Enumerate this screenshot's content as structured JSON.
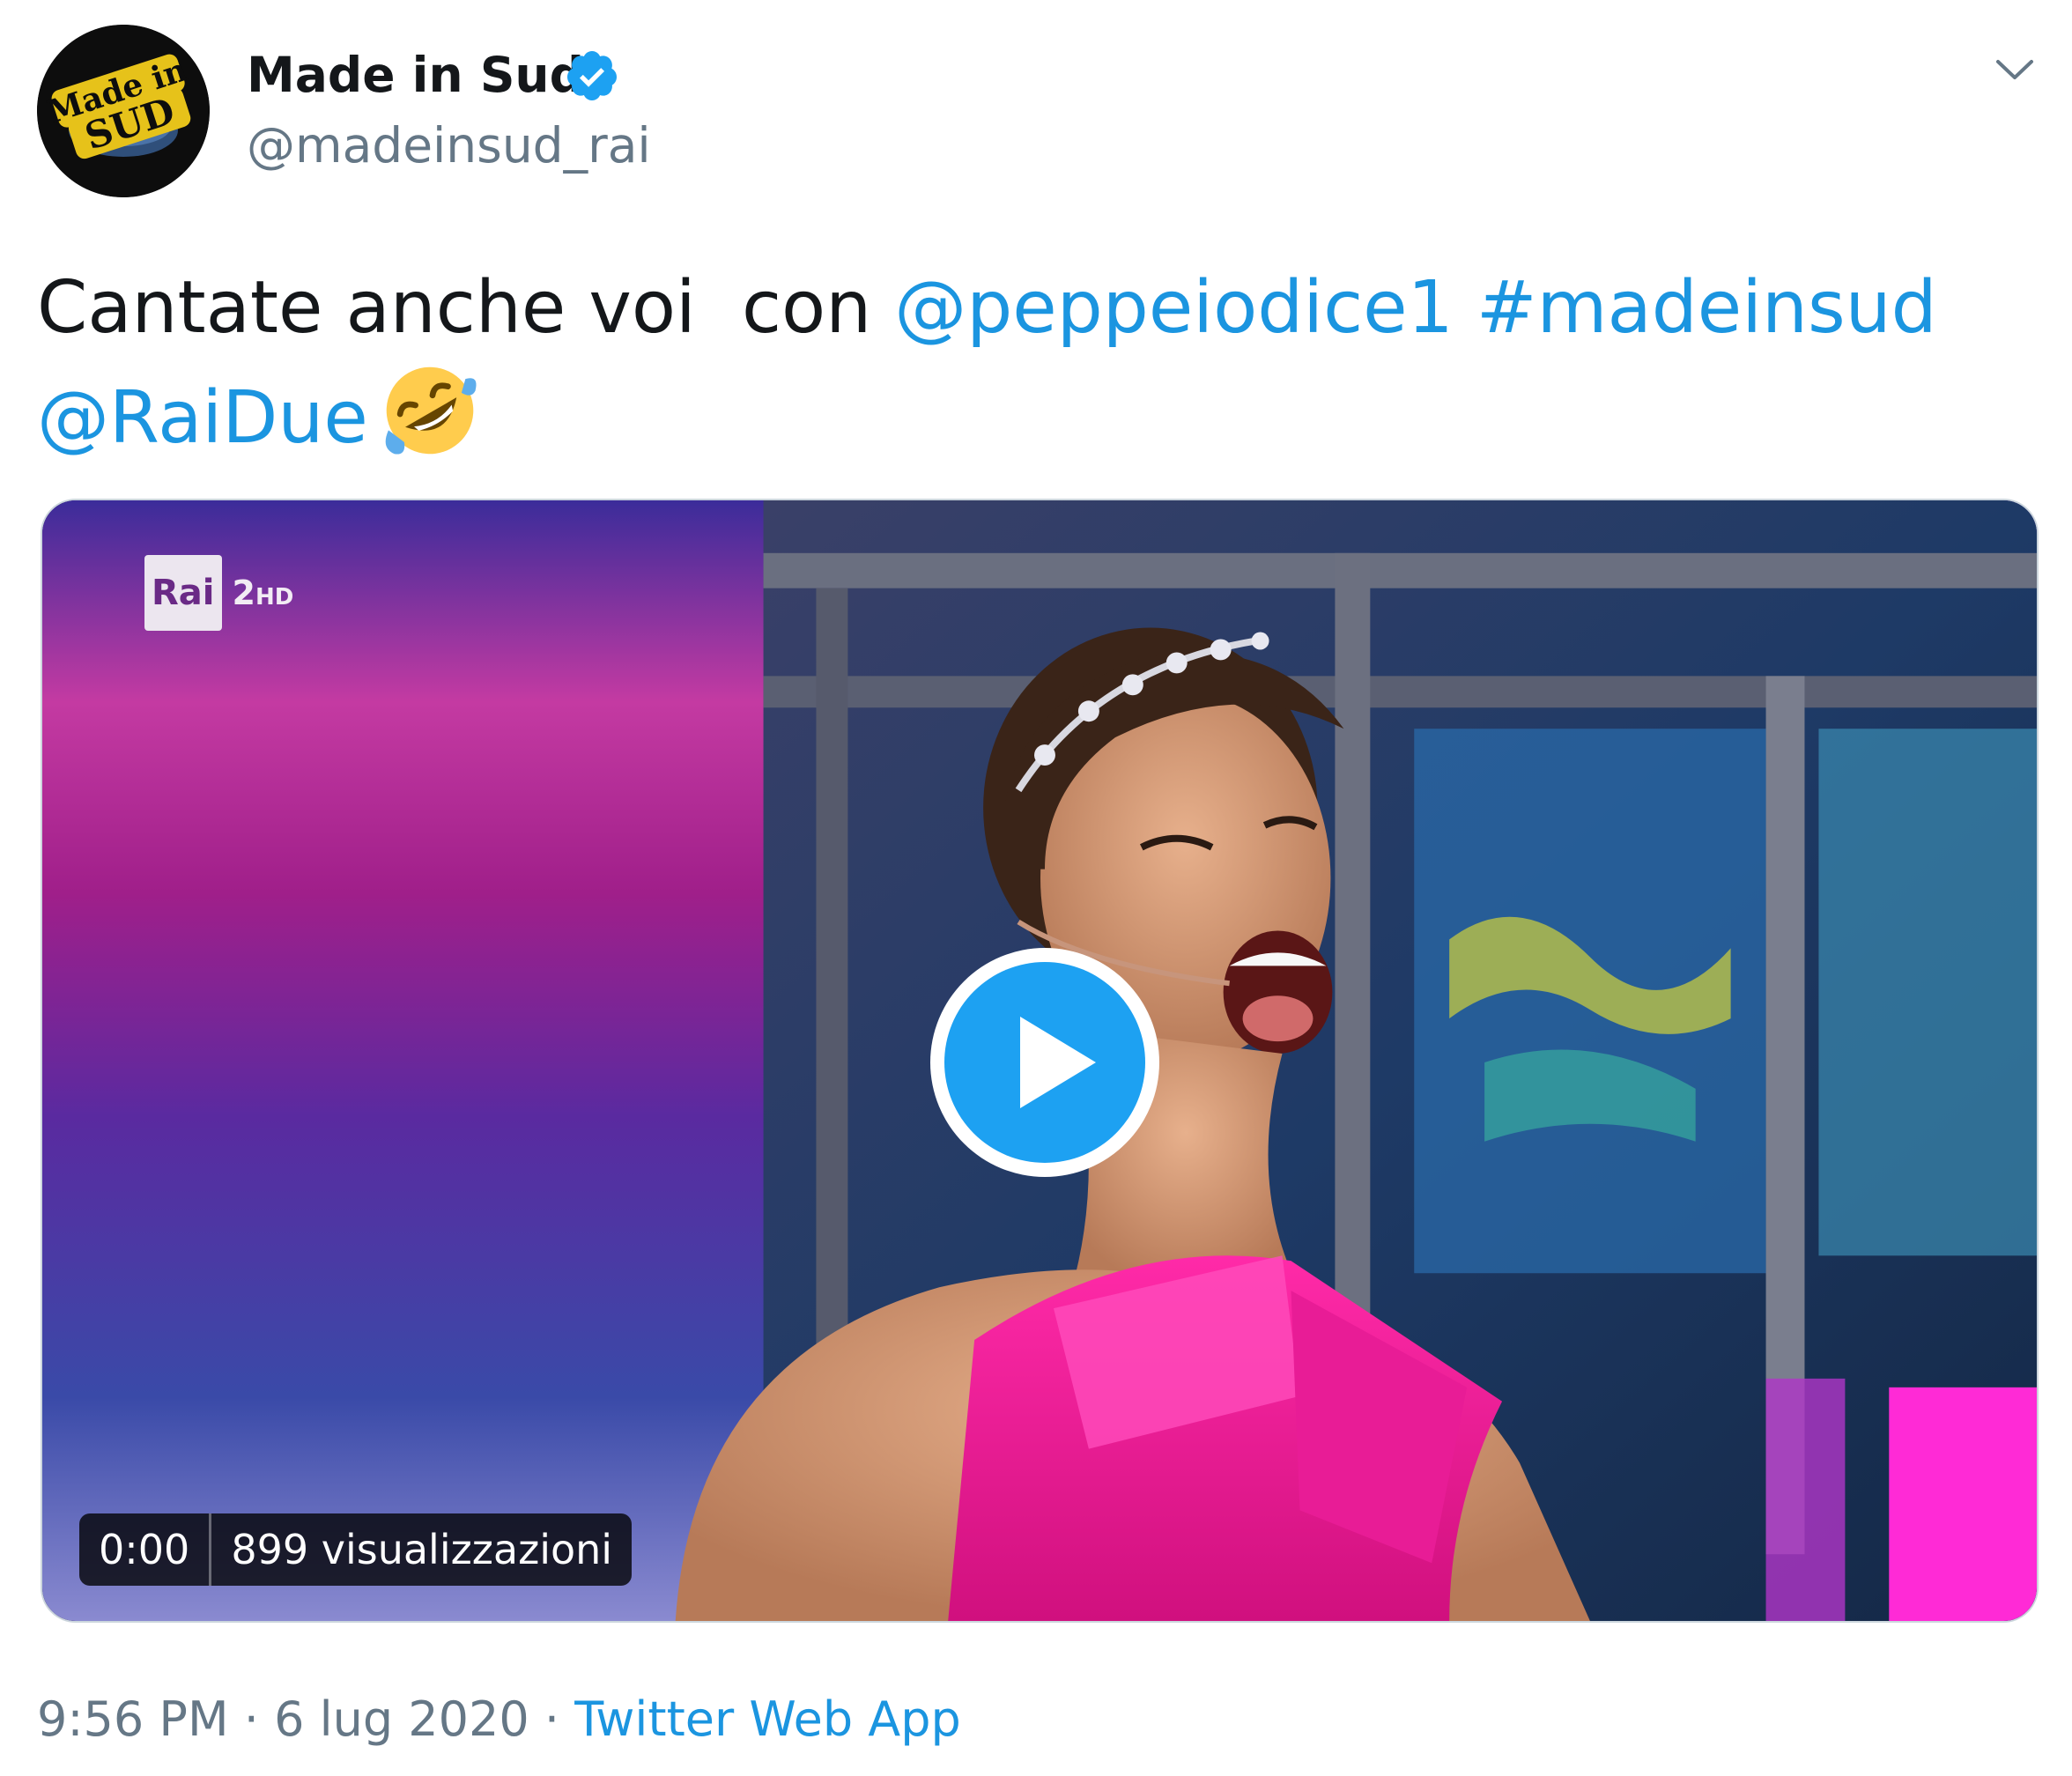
{
  "header": {
    "display_name": "Made in Sud",
    "handle": "@madeinsud_rai",
    "avatar_text": "Made in SUD",
    "verified_icon": "verified-badge-icon",
    "menu_icon": "chevron-down-icon"
  },
  "tweet": {
    "text_plain_1": "Cantate anche voi  con ",
    "mention_1": "@peppeiodice1",
    "hashtag_1": "#madeinsud",
    "mention_2": "@RaiDue",
    "emoji": "rolling-on-the-floor-laughing"
  },
  "media": {
    "channel_logo_rai": "Rai",
    "channel_logo_num": "2",
    "channel_logo_hd": "HD",
    "play_icon": "play-icon",
    "duration": "0:00",
    "views": "899 visualizzazioni"
  },
  "footer": {
    "time": "9:56 PM",
    "separator_1": " · ",
    "date": "6 lug 2020",
    "separator_2": " · ",
    "source": "Twitter Web App"
  },
  "colors": {
    "link": "#1b95e0",
    "secondary_text": "#657786",
    "primary_text": "#14171a",
    "verified": "#1da1f2"
  }
}
